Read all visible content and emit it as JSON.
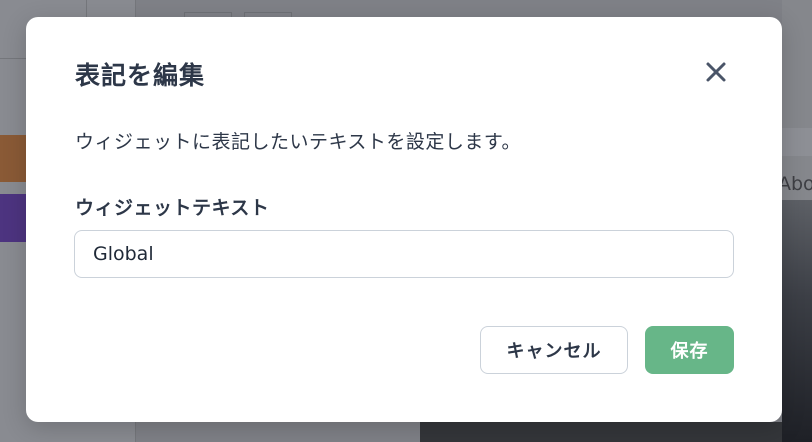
{
  "background": {
    "partial_text": "Abo"
  },
  "modal": {
    "title": "表記を編集",
    "close_icon": "close-icon",
    "description": "ウィジェットに表記したいテキストを設定します。",
    "field": {
      "label": "ウィジェットテキスト",
      "value": "Global"
    },
    "buttons": {
      "cancel_label": "キャンセル",
      "save_label": "保存"
    }
  },
  "colors": {
    "overlay": "#7f8187",
    "modal_bg": "#ffffff",
    "text": "#2d3748",
    "border": "#cbd2da",
    "save_button": "#67b688",
    "close_icon": "#4a5568"
  }
}
